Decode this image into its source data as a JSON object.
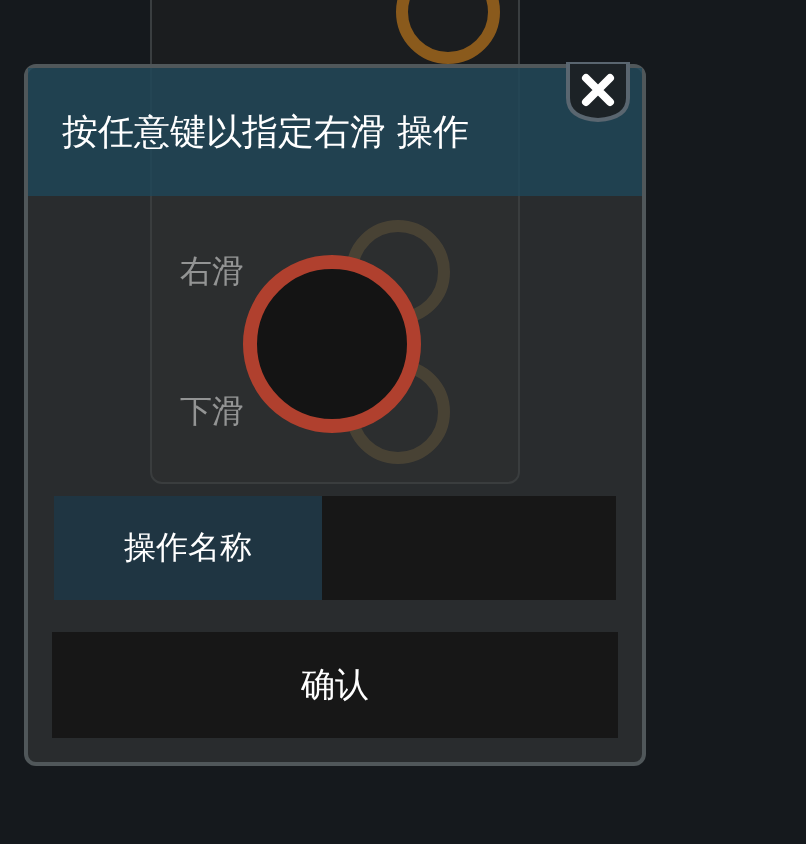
{
  "background_panel": {
    "labels": [
      "右滑",
      "下滑"
    ]
  },
  "dialog": {
    "title": "按任意键以指定右滑 操作",
    "name_field": {
      "label": "操作名称"
    },
    "confirm_button": "确认"
  }
}
